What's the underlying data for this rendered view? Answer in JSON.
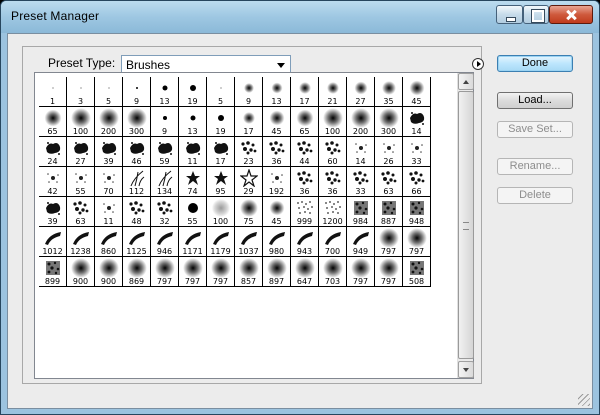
{
  "window": {
    "title": "Preset Manager"
  },
  "preset_type": {
    "label": "Preset Type:",
    "value": "Brushes"
  },
  "buttons": {
    "done": "Done",
    "load": "Load...",
    "save_set": "Save Set...",
    "rename": "Rename...",
    "delete": "Delete"
  },
  "brushes": [
    "1",
    "3",
    "5",
    "9",
    "13",
    "19",
    "5",
    "9",
    "13",
    "17",
    "21",
    "27",
    "35",
    "45",
    "65",
    "100",
    "200",
    "300",
    "9",
    "13",
    "19",
    "17",
    "45",
    "65",
    "100",
    "200",
    "300",
    "14",
    "24",
    "27",
    "39",
    "46",
    "59",
    "11",
    "17",
    "23",
    "36",
    "44",
    "60",
    "14",
    "26",
    "33",
    "42",
    "55",
    "70",
    "112",
    "134",
    "74",
    "95",
    "29",
    "192",
    "36",
    "36",
    "33",
    "63",
    "66",
    "39",
    "63",
    "11",
    "48",
    "32",
    "55",
    "100",
    "75",
    "45",
    "999",
    "1200",
    "984",
    "887",
    "948",
    "1012",
    "1238",
    "860",
    "1125",
    "946",
    "1171",
    "1179",
    "1037",
    "980",
    "943",
    "700",
    "949",
    "797",
    "797",
    "899",
    "900",
    "900",
    "869",
    "797",
    "797",
    "797",
    "857",
    "897",
    "647",
    "703",
    "797",
    "797",
    "508"
  ],
  "brush_icons": [
    "dot",
    "dot",
    "dot",
    "dot",
    "hard",
    "hard",
    "dot",
    "soft",
    "soft",
    "soft",
    "soft",
    "soft",
    "soft",
    "soft",
    "soft",
    "soft",
    "soft",
    "soft",
    "hard",
    "hard",
    "hard",
    "soft",
    "soft",
    "soft",
    "soft",
    "soft",
    "soft",
    "splat",
    "splat",
    "splat",
    "splat",
    "splat",
    "splat",
    "splat",
    "splat",
    "scatter",
    "scatter",
    "scatter",
    "scatter",
    "spark",
    "spark",
    "spark",
    "spark",
    "spark",
    "spark",
    "grass",
    "grass",
    "leaf",
    "leaf",
    "star",
    "spark",
    "scatter",
    "scatter",
    "scatter",
    "scatter",
    "scatter",
    "splat",
    "scatter",
    "spark",
    "scatter",
    "scatter",
    "hard",
    "softlight",
    "soft",
    "soft",
    "dots",
    "dots",
    "texture",
    "texture",
    "texture",
    "stroke",
    "stroke",
    "stroke",
    "stroke",
    "stroke",
    "stroke",
    "stroke",
    "stroke",
    "stroke",
    "stroke",
    "stroke",
    "stroke",
    "soft",
    "soft",
    "texture",
    "soft",
    "soft",
    "soft",
    "soft",
    "soft",
    "soft",
    "soft",
    "soft",
    "soft",
    "soft",
    "soft",
    "soft",
    "texture"
  ]
}
